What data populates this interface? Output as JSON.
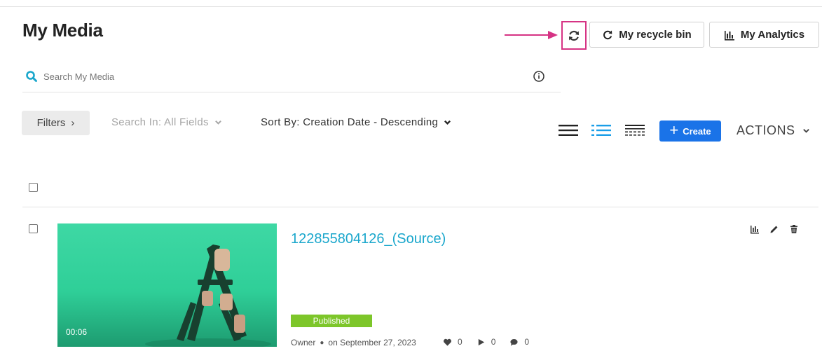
{
  "page": {
    "title": "My Media"
  },
  "header": {
    "recycle_label": "My recycle bin",
    "analytics_label": "My Analytics"
  },
  "search": {
    "placeholder": "Search My Media",
    "value": ""
  },
  "toolbar": {
    "filters_label": "Filters",
    "search_in_label": "Search In: All Fields",
    "sort_by_label": "Sort By: Creation Date - Descending",
    "create_label": "Create",
    "actions_label": "ACTIONS"
  },
  "icons": {
    "search": "search-icon",
    "info": "info-icon",
    "refresh": "refresh-icon",
    "recycle": "recycle-icon",
    "analytics": "analytics-icon",
    "list_view": "list-view-icon",
    "detailed_view": "detailed-view-icon",
    "compact_view": "compact-view-icon",
    "plus": "plus-icon"
  },
  "colors": {
    "accent_blue": "#1a73e8",
    "title_link": "#1ba7cc",
    "published_green": "#7dc62a",
    "highlight_pink": "#d63384"
  },
  "media": {
    "items": [
      {
        "title": "122855804126_(Source)",
        "duration": "00:06",
        "status": "Published",
        "owner_label": "Owner",
        "date_label": "on September 27, 2023",
        "likes": "0",
        "plays": "0",
        "comments": "0"
      }
    ]
  }
}
